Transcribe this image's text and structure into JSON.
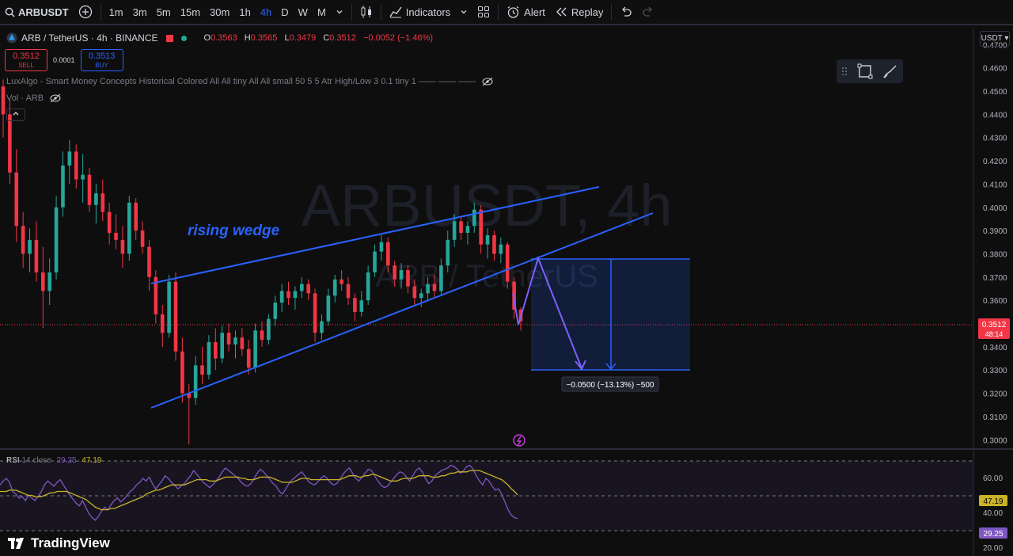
{
  "toolbar": {
    "symbol": "ARBUSDT",
    "timeframes": [
      "1m",
      "3m",
      "5m",
      "15m",
      "30m",
      "1h",
      "4h",
      "D",
      "W",
      "M"
    ],
    "active_timeframe": "4h",
    "indicators_label": "Indicators",
    "alert_label": "Alert",
    "replay_label": "Replay"
  },
  "legend": {
    "title": "ARB / TetherUS · 4h · BINANCE",
    "o_label": "O",
    "o": "0.3563",
    "h_label": "H",
    "h": "0.3565",
    "l_label": "L",
    "l": "0.3479",
    "c_label": "C",
    "c": "0.3512",
    "change": "−0.0052 (−1.46%)"
  },
  "trade": {
    "sell_price": "0.3512",
    "sell_label": "SELL",
    "spread": "0.0001",
    "buy_price": "0.3513",
    "buy_label": "BUY"
  },
  "indicators": {
    "luxalgo": "LuxAlgo - Smart Money Concepts Historical Colored All All tiny All All small 50 5 5 Atr High/Low 3 0.1 tiny 1 —— —— ——",
    "vol": "Vol · ARB"
  },
  "currency": "USDT",
  "watermark": {
    "big": "ARBUSDT, 4h",
    "small": "ARB / TetherUS"
  },
  "annotation": {
    "text": "rising wedge",
    "measure": "−0.0500 (−13.13%) −500"
  },
  "price_scale": {
    "ticks": [
      "0.4700",
      "0.4600",
      "0.4500",
      "0.4400",
      "0.4300",
      "0.4200",
      "0.4100",
      "0.4000",
      "0.3900",
      "0.3800",
      "0.3700",
      "0.3600",
      "0.3400",
      "0.3300",
      "0.3200",
      "0.3100",
      "0.3000"
    ],
    "last_price": "0.3512",
    "countdown": "48:14"
  },
  "rsi": {
    "label": "RSI",
    "params": "14 close",
    "value": "29.25",
    "ma": "47.19",
    "ticks": [
      "60.00",
      "40.00",
      "20.00"
    ]
  },
  "brand": "TradingView",
  "colors": {
    "up": "#26a69a",
    "down": "#f23645",
    "wedge": "#2962ff",
    "rsi": "#7e57c2",
    "rsi_ma": "#c9b428"
  },
  "chart_data": {
    "type": "candlestick",
    "title": "ARB / TetherUS · 4h · BINANCE",
    "ylim": [
      0.296,
      0.4776
    ],
    "candles": [
      [
        0.452,
        0.455,
        0.43,
        0.44
      ],
      [
        0.44,
        0.446,
        0.41,
        0.415
      ],
      [
        0.415,
        0.425,
        0.385,
        0.392
      ],
      [
        0.392,
        0.398,
        0.374,
        0.38
      ],
      [
        0.38,
        0.391,
        0.372,
        0.386
      ],
      [
        0.386,
        0.394,
        0.368,
        0.372
      ],
      [
        0.372,
        0.383,
        0.348,
        0.364
      ],
      [
        0.364,
        0.378,
        0.358,
        0.372
      ],
      [
        0.372,
        0.405,
        0.369,
        0.4
      ],
      [
        0.4,
        0.424,
        0.396,
        0.418
      ],
      [
        0.418,
        0.429,
        0.41,
        0.424
      ],
      [
        0.424,
        0.427,
        0.408,
        0.412
      ],
      [
        0.412,
        0.423,
        0.402,
        0.414
      ],
      [
        0.414,
        0.417,
        0.398,
        0.401
      ],
      [
        0.401,
        0.41,
        0.393,
        0.406
      ],
      [
        0.406,
        0.412,
        0.394,
        0.398
      ],
      [
        0.398,
        0.402,
        0.384,
        0.389
      ],
      [
        0.389,
        0.397,
        0.382,
        0.386
      ],
      [
        0.386,
        0.392,
        0.374,
        0.38
      ],
      [
        0.38,
        0.405,
        0.377,
        0.402
      ],
      [
        0.402,
        0.404,
        0.386,
        0.39
      ],
      [
        0.39,
        0.394,
        0.38,
        0.383
      ],
      [
        0.383,
        0.386,
        0.364,
        0.37
      ],
      [
        0.37,
        0.373,
        0.35,
        0.354
      ],
      [
        0.354,
        0.358,
        0.34,
        0.346
      ],
      [
        0.346,
        0.371,
        0.344,
        0.368
      ],
      [
        0.368,
        0.372,
        0.334,
        0.338
      ],
      [
        0.338,
        0.344,
        0.316,
        0.32
      ],
      [
        0.32,
        0.324,
        0.298,
        0.318
      ],
      [
        0.318,
        0.336,
        0.315,
        0.332
      ],
      [
        0.332,
        0.34,
        0.324,
        0.328
      ],
      [
        0.328,
        0.345,
        0.326,
        0.342
      ],
      [
        0.342,
        0.348,
        0.33,
        0.335
      ],
      [
        0.335,
        0.349,
        0.333,
        0.346
      ],
      [
        0.346,
        0.35,
        0.338,
        0.341
      ],
      [
        0.341,
        0.347,
        0.335,
        0.344
      ],
      [
        0.344,
        0.348,
        0.336,
        0.339
      ],
      [
        0.339,
        0.343,
        0.328,
        0.331
      ],
      [
        0.331,
        0.35,
        0.329,
        0.347
      ],
      [
        0.347,
        0.351,
        0.34,
        0.343
      ],
      [
        0.343,
        0.354,
        0.341,
        0.352
      ],
      [
        0.352,
        0.362,
        0.349,
        0.359
      ],
      [
        0.359,
        0.367,
        0.355,
        0.364
      ],
      [
        0.364,
        0.368,
        0.358,
        0.361
      ],
      [
        0.361,
        0.366,
        0.356,
        0.364
      ],
      [
        0.364,
        0.37,
        0.361,
        0.367
      ],
      [
        0.367,
        0.369,
        0.36,
        0.363
      ],
      [
        0.363,
        0.365,
        0.342,
        0.346
      ],
      [
        0.346,
        0.354,
        0.343,
        0.351
      ],
      [
        0.351,
        0.365,
        0.349,
        0.362
      ],
      [
        0.362,
        0.371,
        0.359,
        0.369
      ],
      [
        0.369,
        0.373,
        0.364,
        0.367
      ],
      [
        0.367,
        0.37,
        0.358,
        0.361
      ],
      [
        0.361,
        0.363,
        0.351,
        0.355
      ],
      [
        0.355,
        0.364,
        0.353,
        0.36
      ],
      [
        0.36,
        0.375,
        0.358,
        0.372
      ],
      [
        0.372,
        0.384,
        0.37,
        0.381
      ],
      [
        0.381,
        0.388,
        0.377,
        0.385
      ],
      [
        0.385,
        0.387,
        0.372,
        0.375
      ],
      [
        0.375,
        0.377,
        0.366,
        0.369
      ],
      [
        0.369,
        0.376,
        0.365,
        0.373
      ],
      [
        0.373,
        0.375,
        0.363,
        0.366
      ],
      [
        0.366,
        0.369,
        0.358,
        0.361
      ],
      [
        0.361,
        0.365,
        0.357,
        0.363
      ],
      [
        0.363,
        0.37,
        0.36,
        0.367
      ],
      [
        0.367,
        0.371,
        0.361,
        0.364
      ],
      [
        0.364,
        0.378,
        0.362,
        0.375
      ],
      [
        0.375,
        0.39,
        0.372,
        0.386
      ],
      [
        0.386,
        0.397,
        0.383,
        0.394
      ],
      [
        0.394,
        0.396,
        0.386,
        0.389
      ],
      [
        0.389,
        0.394,
        0.384,
        0.392
      ],
      [
        0.392,
        0.402,
        0.389,
        0.399
      ],
      [
        0.399,
        0.401,
        0.38,
        0.384
      ],
      [
        0.384,
        0.391,
        0.378,
        0.388
      ],
      [
        0.388,
        0.39,
        0.377,
        0.38
      ],
      [
        0.38,
        0.387,
        0.376,
        0.384
      ],
      [
        0.384,
        0.385,
        0.365,
        0.368
      ],
      [
        0.368,
        0.37,
        0.352,
        0.356
      ],
      [
        0.356,
        0.357,
        0.347,
        0.351
      ]
    ],
    "rsi_ylim": [
      20,
      70
    ],
    "rsi": [
      55,
      58,
      60,
      57,
      50,
      48,
      45,
      46,
      43,
      47,
      45,
      43,
      46,
      50,
      55,
      58,
      56,
      54,
      57,
      59,
      55,
      51,
      47,
      44,
      41,
      39,
      43,
      38,
      33,
      30,
      28,
      31,
      35,
      38,
      36,
      40,
      43,
      45,
      42,
      44,
      47,
      50,
      52,
      55,
      57,
      60,
      58,
      61,
      56,
      52,
      55,
      58,
      62,
      60,
      57,
      55,
      52,
      54,
      56,
      59,
      62,
      66,
      63,
      60,
      57,
      55,
      53,
      55,
      58,
      61,
      65,
      68,
      66,
      64,
      62,
      60,
      57,
      55,
      54,
      56,
      60,
      64,
      67,
      65,
      62,
      59,
      56,
      54,
      50,
      48,
      52,
      56,
      59,
      61,
      63,
      65,
      62,
      58,
      56,
      55,
      57,
      60,
      62,
      60,
      57,
      55,
      56,
      59,
      63,
      66,
      68,
      64,
      60,
      58,
      61,
      64,
      67,
      66,
      62,
      58,
      55,
      53,
      54,
      57,
      60,
      63,
      65,
      64,
      61,
      58,
      62,
      66,
      68,
      65,
      60,
      56,
      58,
      62,
      64,
      66,
      67,
      68,
      70,
      69,
      67,
      64,
      66,
      69,
      70,
      67,
      62,
      58,
      55,
      60,
      58,
      54,
      51,
      52,
      48,
      42,
      36,
      32,
      30,
      29.25
    ],
    "rsi_ma": [
      50,
      50,
      50,
      51,
      51,
      51,
      50,
      49,
      48,
      47,
      47,
      46,
      46,
      46,
      47,
      48,
      49,
      49,
      50,
      50,
      50,
      50,
      49,
      48,
      47,
      46,
      45,
      44,
      42,
      40,
      38,
      37,
      36,
      36,
      36,
      37,
      37,
      38,
      39,
      40,
      41,
      42,
      43,
      44,
      45,
      46,
      48,
      49,
      50,
      51,
      51,
      52,
      53,
      54,
      55,
      55,
      55,
      55,
      55,
      56,
      57,
      58,
      59,
      59,
      59,
      59,
      58,
      58,
      58,
      59,
      60,
      61,
      61,
      61,
      61,
      61,
      60,
      60,
      59,
      59,
      59,
      60,
      61,
      61,
      61,
      61,
      60,
      59,
      58,
      57,
      57,
      57,
      57,
      58,
      59,
      60,
      60,
      60,
      59,
      59,
      59,
      59,
      59,
      59,
      59,
      59,
      59,
      59,
      60,
      61,
      62,
      62,
      62,
      61,
      61,
      62,
      62,
      63,
      63,
      62,
      61,
      60,
      59,
      58,
      58,
      58,
      59,
      60,
      60,
      60,
      60,
      61,
      62,
      62,
      62,
      62,
      61,
      61,
      61,
      62,
      62,
      63,
      64,
      64,
      65,
      65,
      65,
      65,
      66,
      66,
      66,
      66,
      65,
      64,
      63,
      62,
      61,
      60,
      59,
      57,
      55,
      52,
      50,
      47.19
    ]
  }
}
